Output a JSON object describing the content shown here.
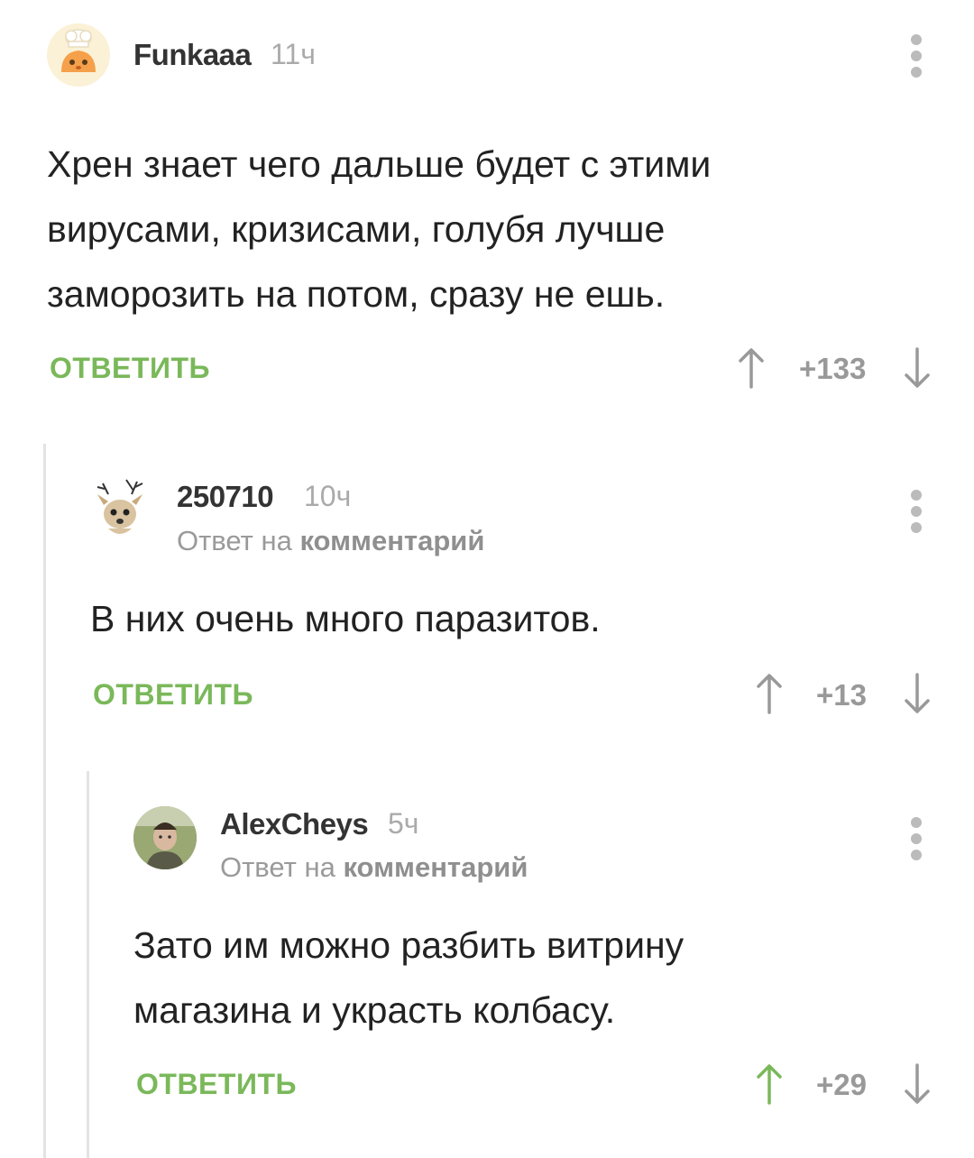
{
  "comments": [
    {
      "author": "Funkaaa",
      "time": "11ч",
      "text_lines": [
        "Хрен знает чего дальше будет с этими",
        "вирусами, кризисами, голубя лучше",
        "заморозить на потом, сразу не ешь."
      ],
      "reply_label": "ОТВЕТИТЬ",
      "score": "+133"
    },
    {
      "author": "250710",
      "time": "10ч",
      "reply_to_prefix": "Ответ на",
      "reply_to_link": "комментарий",
      "text_lines": [
        "В них очень много паразитов."
      ],
      "reply_label": "ОТВЕТИТЬ",
      "score": "+13"
    },
    {
      "author": "AlexCheys",
      "time": "5ч",
      "reply_to_prefix": "Ответ на",
      "reply_to_link": "комментарий",
      "text_lines": [
        "Зато им можно разбить витрину",
        "магазина и украсть колбасу."
      ],
      "reply_label": "ОТВЕТИТЬ",
      "score": "+29"
    }
  ],
  "colors": {
    "accent": "#7ab85a",
    "muted": "#999999",
    "text": "#222222",
    "upvoted": "#7ab85a"
  },
  "icons": {
    "up": "arrow-up-icon",
    "down": "arrow-down-icon",
    "menu": "kebab-menu-icon"
  }
}
